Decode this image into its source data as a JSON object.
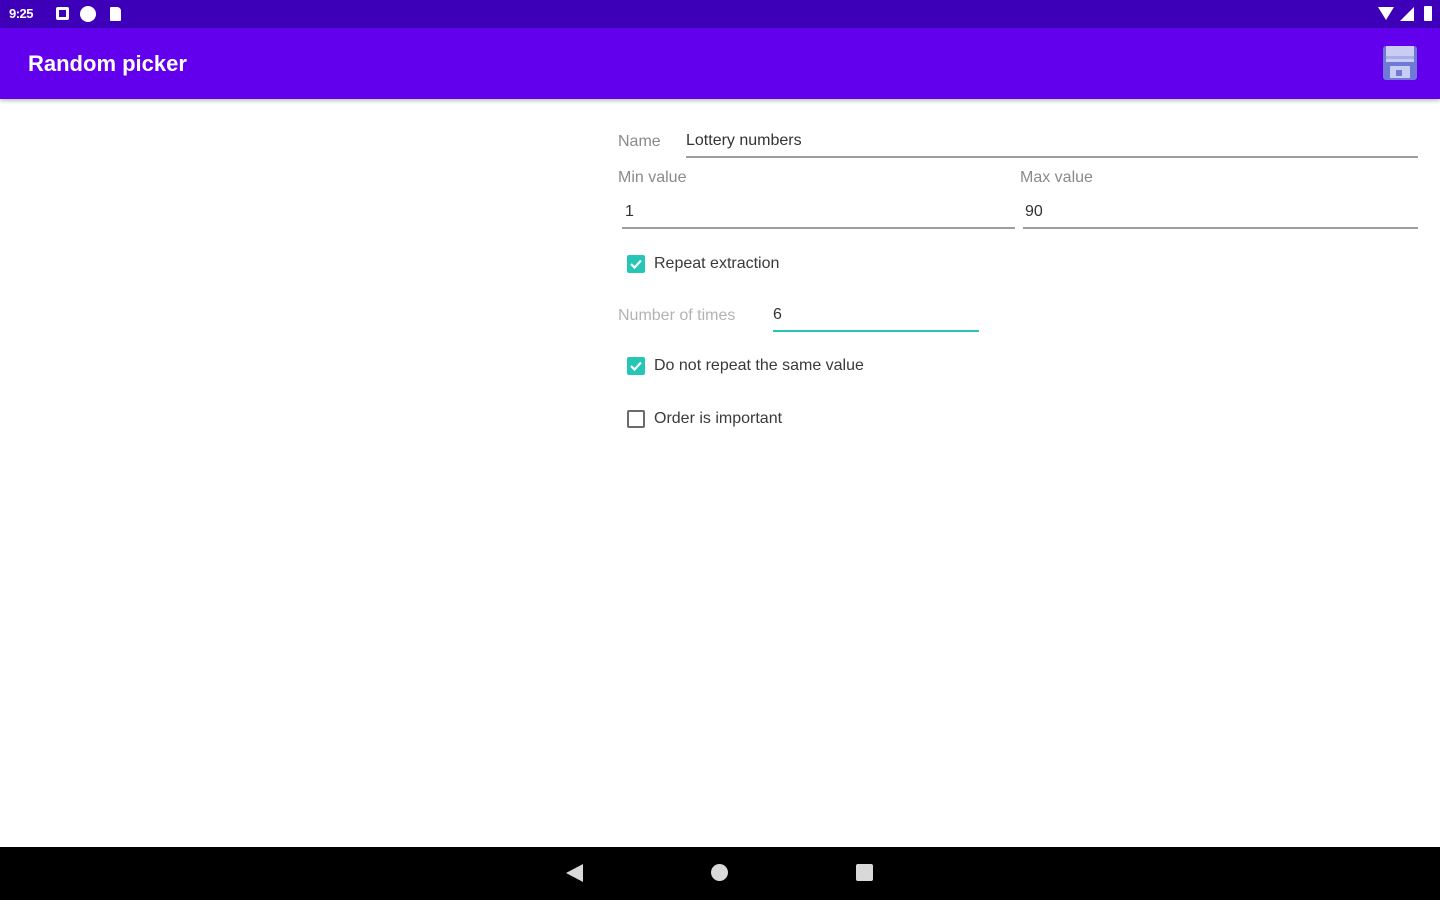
{
  "status_bar": {
    "time": "9:25",
    "icons": [
      "notification-icon",
      "p-icon",
      "sd-card-icon",
      "wifi-icon",
      "signal-icon",
      "battery-icon"
    ]
  },
  "app_bar": {
    "title": "Random picker",
    "action_icon": "save-icon",
    "color": "#6200ee"
  },
  "form": {
    "name_label": "Name",
    "name_value": "Lottery numbers",
    "min_label": "Min value",
    "min_value": "1",
    "max_label": "Max value",
    "max_value": "90",
    "repeat_extraction_label": "Repeat extraction",
    "repeat_extraction_checked": true,
    "times_label": "Number of times",
    "times_value": "6",
    "no_repeat_label": "Do not repeat the same value",
    "no_repeat_checked": true,
    "order_label": "Order is important",
    "order_checked": false,
    "accent_color": "#26c6b6"
  },
  "nav_bar": {
    "buttons": [
      "back-icon",
      "home-icon",
      "recents-icon"
    ]
  }
}
